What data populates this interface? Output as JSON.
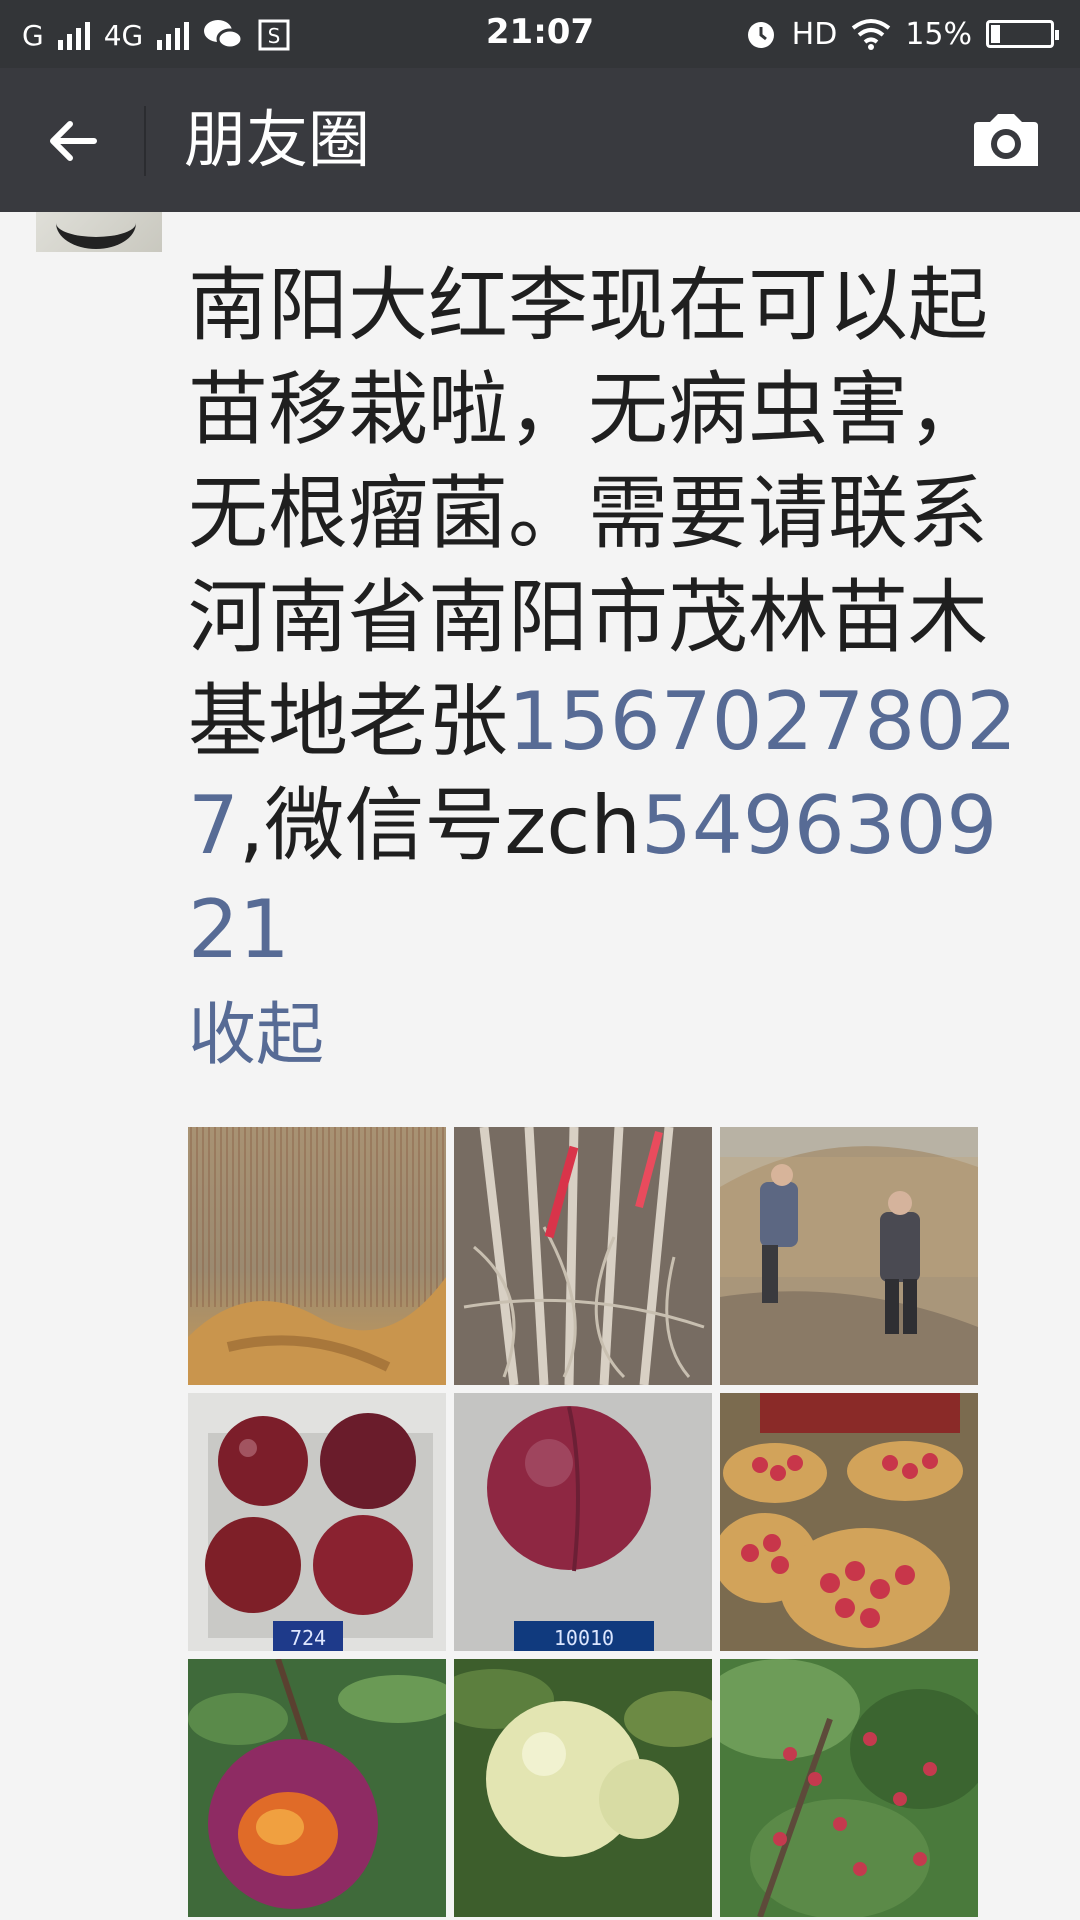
{
  "status_bar": {
    "network_1": "G",
    "network_2": "4G",
    "time": "21:07",
    "hd": "HD",
    "battery_percent": "15%",
    "battery_level": 0.15
  },
  "header": {
    "title": "朋友圈"
  },
  "post": {
    "text_before_phone": "南阳大红李现在可以起苗移栽啦，无病虫害，无根瘤菌。需要请联系河南省南阳市茂林苗木基地老张",
    "phone": "15670278027",
    "text_after_phone": ",微信号zch",
    "wechat_digits": "549630921",
    "collapse_label": "收起"
  }
}
